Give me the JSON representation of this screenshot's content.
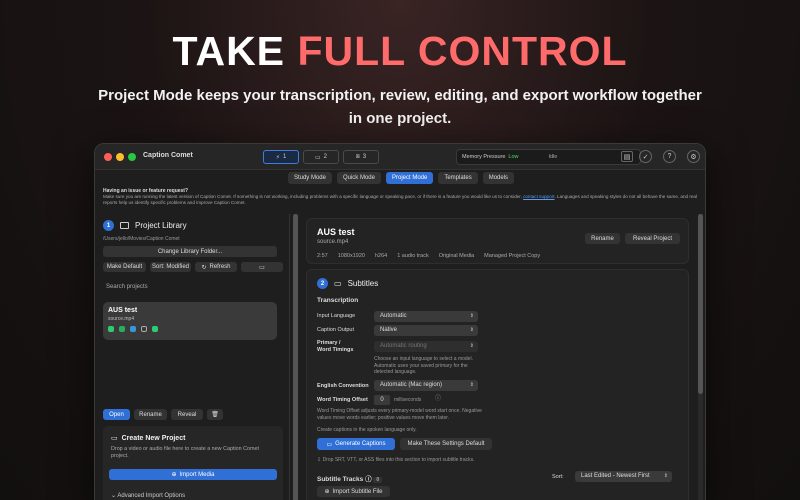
{
  "hero": {
    "title_plain": "TAKE",
    "title_accent": "FULL CONTROL",
    "subtitle": "Project Mode keeps your transcription, review, editing, and export workflow together in one project."
  },
  "window": {
    "app_name": "Caption Comet",
    "queues": [
      {
        "icon": "bolt-icon",
        "count": "1"
      },
      {
        "icon": "caption-icon",
        "count": "2"
      },
      {
        "icon": "box-icon",
        "count": "3"
      }
    ],
    "memory_label": "Memory Pressure",
    "memory_value": "Low",
    "status": "Idle",
    "modes": [
      "Study Mode",
      "Quick Mode",
      "Project Mode",
      "Templates",
      "Models"
    ],
    "selected_mode": "Project Mode",
    "notice_title": "Having an issue or feature request?",
    "notice_body_1": "Make sure you are running the latest version of Caption Comet. If something is not working, including problems with a specific language or speaking pace, or if there is a feature you would like us to consider,",
    "notice_link": "contact support",
    "notice_body_2": ". Languages and speaking styles do not all behave the same, and real reports help us identify specific problems and improve Caption Comet."
  },
  "library": {
    "step": "1",
    "title": "Project Library",
    "path": "/Users/jello/Movies/Caption Comet",
    "change_folder": "Change Library Folder...",
    "make_default": "Make Default",
    "sort": "Sort: Modified",
    "refresh": "Refresh",
    "search_placeholder": "Search projects",
    "project": {
      "title": "AUS test",
      "file": "source.mp4"
    },
    "actions": {
      "open": "Open",
      "rename": "Rename",
      "reveal": "Reveal"
    },
    "create": {
      "title": "Create New Project",
      "desc": "Drop a video or audio file here to create a new Caption Comet project.",
      "import": "Import Media",
      "advanced": "Advanced Import Options"
    }
  },
  "project": {
    "title": "AUS test",
    "source": "source.mp4",
    "meta": [
      "2:57",
      "1080x1920",
      "h264",
      "1 audio track",
      "Original Media",
      "Managed Project Copy"
    ],
    "rename": "Rename",
    "reveal": "Reveal Project"
  },
  "subtitles": {
    "step": "2",
    "title": "Subtitles",
    "transcription": "Transcription",
    "input_language_label": "Input Language",
    "input_language": "Automatic",
    "caption_output_label": "Caption Output",
    "caption_output": "Native",
    "primary_label_1": "Primary /",
    "primary_label_2": "Word Timings",
    "primary_value": "Automatic routing",
    "primary_hint": "Choose an input language to select a model. Automatic uses your saved primary for the detected language.",
    "english_label": "English Convention",
    "english_value": "Automatic (Mac region)",
    "offset_label": "Word Timing Offset",
    "offset_value": "0",
    "offset_unit": "milliseconds",
    "offset_hint": "Word Timing Offset adjusts every primary-model word start once. Negative values move words earlier; positive values move them later.",
    "create_hint": "Create captions in the spoken language only.",
    "generate": "Generate Captions",
    "make_default": "Make These Settings Default",
    "drop_hint": "Drop SRT, VTT, or ASS files into this section to import subtitle tracks.",
    "tracks_label": "Subtitle Tracks",
    "tracks_count": "0",
    "sort_label": "Sort:",
    "sort_value": "Last Edited - Newest First",
    "import_subtitle": "Import Subtitle File"
  }
}
